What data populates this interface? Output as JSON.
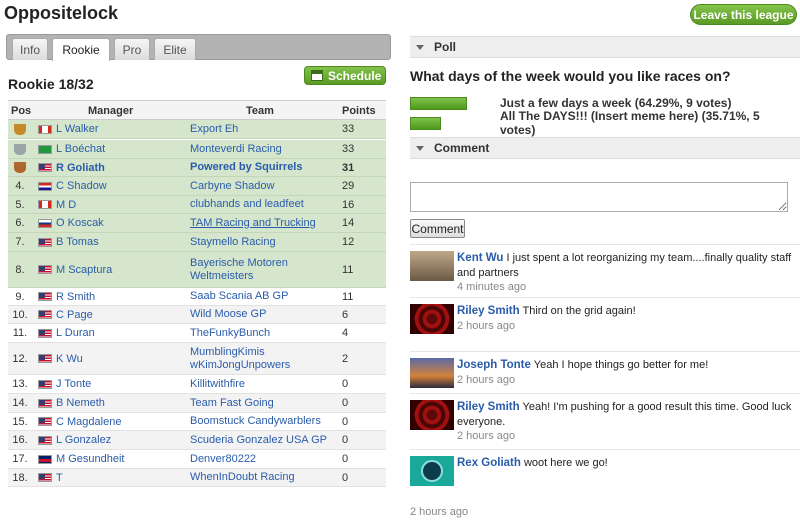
{
  "header": {
    "title": "Oppositelock",
    "leave_label": "Leave this league"
  },
  "tabs": [
    {
      "label": "Info",
      "active": false
    },
    {
      "label": "Rookie",
      "active": true
    },
    {
      "label": "Pro",
      "active": false
    },
    {
      "label": "Elite",
      "active": false
    }
  ],
  "league": {
    "title": "Rookie 18/32",
    "schedule_label": "Schedule"
  },
  "table": {
    "columns": [
      "Pos",
      "Manager",
      "Team",
      "Points"
    ],
    "rows": [
      {
        "pos": "",
        "trophy": "gold",
        "flag": "ca",
        "manager": "L Walker",
        "team": "Export Eh",
        "points": "33",
        "style": "top"
      },
      {
        "pos": "",
        "trophy": "silver",
        "flag": "br",
        "manager": "L Boéchat",
        "team": "Monteverdi Racing",
        "points": "33",
        "style": "top"
      },
      {
        "pos": "",
        "trophy": "bronze",
        "flag": "us",
        "manager": "R Goliath",
        "team": "Powered by Squirrels",
        "points": "31",
        "style": "top",
        "bold": true
      },
      {
        "pos": "4.",
        "trophy": "",
        "flag": "hr",
        "manager": "C Shadow",
        "team": "Carbyne Shadow",
        "points": "29",
        "style": "top"
      },
      {
        "pos": "5.",
        "trophy": "",
        "flag": "ca",
        "manager": "M D",
        "team": "clubhands and leadfeet",
        "points": "16",
        "style": "top"
      },
      {
        "pos": "6.",
        "trophy": "",
        "flag": "si",
        "manager": "O Koscak",
        "team": "TAM Racing and Trucking",
        "points": "14",
        "style": "top",
        "underline": true
      },
      {
        "pos": "7.",
        "trophy": "",
        "flag": "us",
        "manager": "B Tomas",
        "team": "Staymello Racing",
        "points": "12",
        "style": "top"
      },
      {
        "pos": "8.",
        "trophy": "",
        "flag": "us",
        "manager": "M Scaptura",
        "team": "Bayerische Motoren Weltmeisters",
        "points": "11",
        "style": "top"
      },
      {
        "pos": "9.",
        "trophy": "",
        "flag": "us",
        "manager": "R Smith",
        "team": "Saab Scania AB GP",
        "points": "11",
        "style": "plain"
      },
      {
        "pos": "10.",
        "trophy": "",
        "flag": "us",
        "manager": "C Page",
        "team": "Wild Moose GP",
        "points": "6",
        "style": "alt"
      },
      {
        "pos": "11.",
        "trophy": "",
        "flag": "us",
        "manager": "L Duran",
        "team": "TheFunkyBunch",
        "points": "4",
        "style": "plain"
      },
      {
        "pos": "12.",
        "trophy": "",
        "flag": "us",
        "manager": "K Wu",
        "team": "MumblingKimis wKimJongUnpowers",
        "points": "2",
        "style": "alt"
      },
      {
        "pos": "13.",
        "trophy": "",
        "flag": "us",
        "manager": "J Tonte",
        "team": "Killitwithfire",
        "points": "0",
        "style": "plain"
      },
      {
        "pos": "14.",
        "trophy": "",
        "flag": "us",
        "manager": "B Nemeth",
        "team": "Team Fast Going",
        "points": "0",
        "style": "alt"
      },
      {
        "pos": "15.",
        "trophy": "",
        "flag": "us",
        "manager": "C Magdalene",
        "team": "Boomstuck Candywarblers",
        "points": "0",
        "style": "plain"
      },
      {
        "pos": "16.",
        "trophy": "",
        "flag": "us",
        "manager": "L Gonzalez",
        "team": "Scuderia Gonzalez USA GP",
        "points": "0",
        "style": "alt"
      },
      {
        "pos": "17.",
        "trophy": "",
        "flag": "gb",
        "manager": "M Gesundheit",
        "team": "Denver80222",
        "points": "0",
        "style": "plain"
      },
      {
        "pos": "18.",
        "trophy": "",
        "flag": "us",
        "manager": "T",
        "team": "WhenInDoubt Racing",
        "points": "0",
        "style": "alt"
      }
    ]
  },
  "poll": {
    "section_label": "Poll",
    "question": "What days of the week would you like races on?",
    "options": [
      {
        "label": "Just a few days a week (64.29%, 9 votes)",
        "percent": 64.29
      },
      {
        "label": "All The DAYS!!! (Insert meme here) (35.71%, 5 votes)",
        "percent": 35.71
      }
    ]
  },
  "comments": {
    "section_label": "Comment",
    "input_value": "",
    "button_label": "Comment",
    "items": [
      {
        "name": "Kent Wu",
        "text": "I just spent a lot reorganizing my team....finally quality staff and partners",
        "time": "4 minutes ago",
        "avatar": "car"
      },
      {
        "name": "Riley Smith",
        "text": "Third on the grid again!",
        "time": "2 hours ago",
        "avatar": "red"
      },
      {
        "name": "Joseph Tonte",
        "text": "Yeah I hope things go better for me!",
        "time": "2 hours ago",
        "avatar": "night"
      },
      {
        "name": "Riley Smith",
        "text": "Yeah! I'm pushing for a good result this time. Good luck everyone.",
        "time": "2 hours ago",
        "avatar": "red"
      },
      {
        "name": "Rex Goliath",
        "text": "woot here we go!",
        "time": "2 hours ago",
        "avatar": "green"
      }
    ]
  }
}
